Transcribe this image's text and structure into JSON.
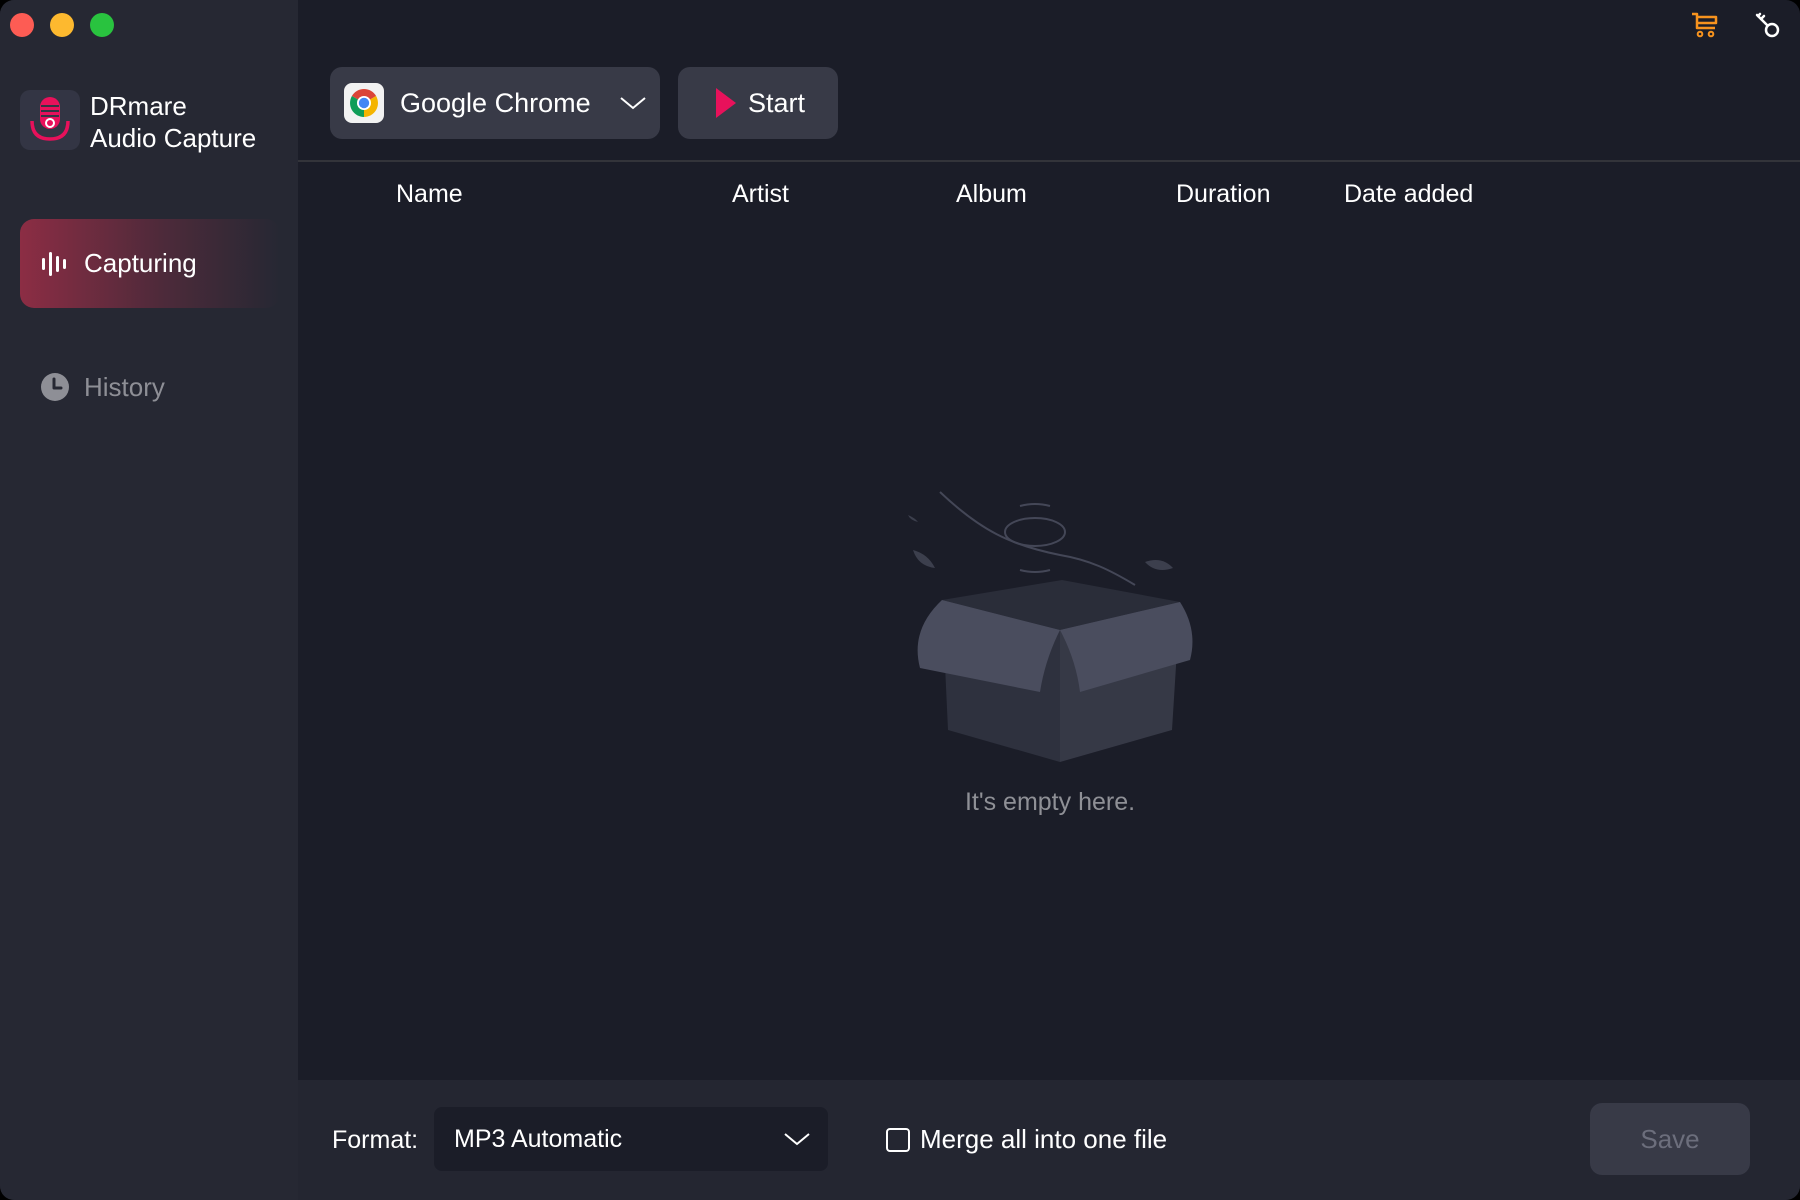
{
  "window": {
    "traffic_lights": [
      "close",
      "minimize",
      "maximize"
    ]
  },
  "app": {
    "name_line1": "DRmare",
    "name_line2": "Audio Capture",
    "logo_icon": "microphone-icon"
  },
  "sidebar": {
    "items": [
      {
        "label": "Capturing",
        "icon": "sound-wave-icon",
        "active": true
      },
      {
        "label": "History",
        "icon": "clock-icon",
        "active": false
      }
    ]
  },
  "topbar": {
    "icons": [
      "cart-icon",
      "key-icon"
    ],
    "cart_color": "#f7931e"
  },
  "toolbar": {
    "source_app": "Google Chrome",
    "source_icon": "chrome-icon",
    "start_label": "Start",
    "start_icon_color": "#e8115b"
  },
  "table": {
    "columns": [
      "Name",
      "Artist",
      "Album",
      "Duration",
      "Date added"
    ],
    "rows": []
  },
  "empty_state": {
    "message": "It's empty here.",
    "illustration": "open-box"
  },
  "footer": {
    "format_label": "Format:",
    "format_value": "MP3 Automatic",
    "merge_label": "Merge all into one file",
    "merge_checked": false,
    "save_label": "Save",
    "save_enabled": false
  },
  "colors": {
    "accent": "#e8115b",
    "active_nav": "#8c2d44",
    "background": "#1b1d28",
    "sidebar": "#262833"
  }
}
